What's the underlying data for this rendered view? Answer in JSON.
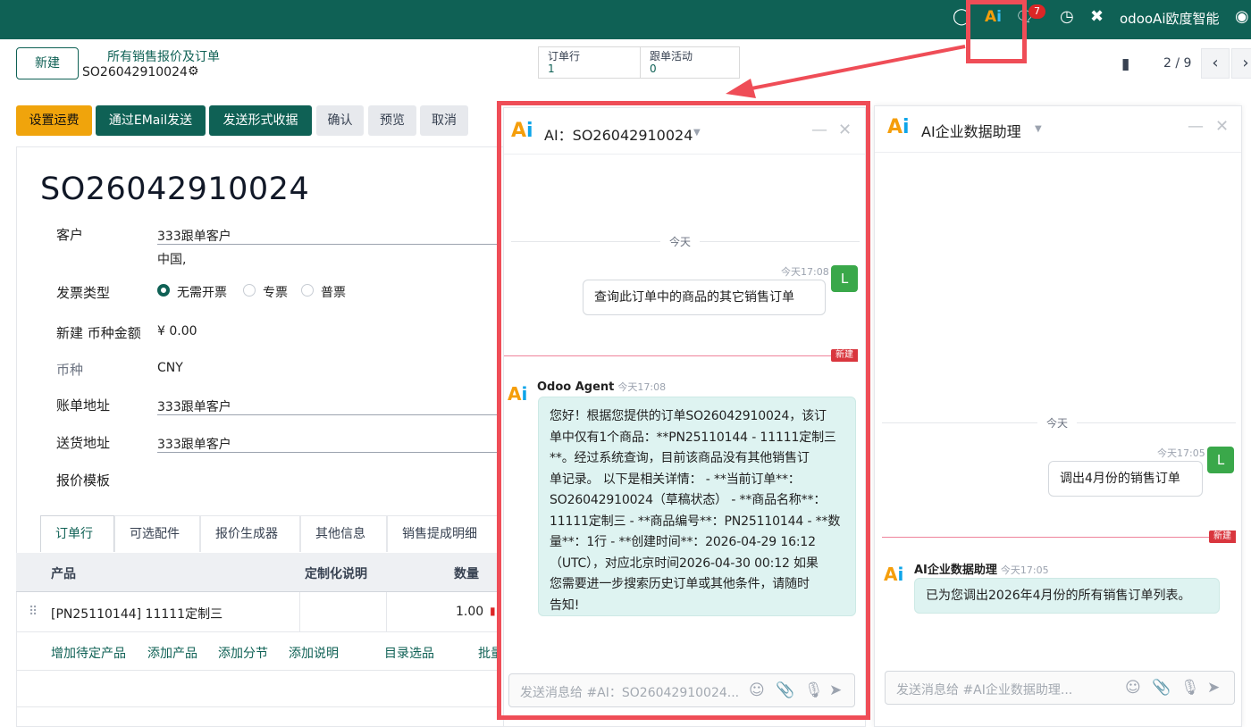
{
  "navbar": {
    "ai_a": "A",
    "ai_i": "i",
    "badge": "7",
    "company": "odooAi欧度智能"
  },
  "control": {
    "new_label": "新建",
    "breadcrumb_parent": "所有销售报价及订单",
    "breadcrumb_current": "SO26042910024",
    "smart_order_lines_label": "订单行",
    "smart_order_lines_value": "1",
    "smart_activities_label": "跟单活动",
    "smart_activities_value": "0",
    "pager": "2 / 9"
  },
  "status_buttons": {
    "shipping": "设置运费",
    "email": "通过EMail发送",
    "proforma": "发送形式收据",
    "confirm": "确认",
    "preview": "预览",
    "cancel": "取消"
  },
  "form": {
    "title": "SO26042910024",
    "customer_label": "客户",
    "customer_value": "333跟单客户",
    "customer_country": "中国,",
    "invoice_type_label": "发票类型",
    "invoice_options": [
      "无需开票",
      "专票",
      "普票"
    ],
    "amount_label": "新建 币种金额",
    "amount_value": "¥ 0.00",
    "currency_label": "币种",
    "currency_value": "CNY",
    "invoice_address_label": "账单地址",
    "invoice_address_value": "333跟单客户",
    "delivery_address_label": "送货地址",
    "delivery_address_value": "333跟单客户",
    "quote_template_label": "报价模板"
  },
  "notebook": {
    "tabs": [
      "订单行",
      "可选配件",
      "报价生成器",
      "其他信息",
      "销售提成明细"
    ],
    "columns": [
      "产品",
      "定制化说明",
      "数量"
    ],
    "row": {
      "product": "[PN25110144] 11111定制三",
      "qty": "1.00"
    },
    "actions": [
      "增加待定产品",
      "添加产品",
      "添加分节",
      "添加说明",
      "目录选品",
      "批量"
    ]
  },
  "chat_order": {
    "title": "AI：SO26042910024",
    "day": "今天",
    "user_ts": "今天17:08",
    "user_avatar": "L",
    "user_msg": "查询此订单中的商品的其它销售订单",
    "new_tag": "新建",
    "agent_name": "Odoo Agent",
    "agent_ts": "今天17:08",
    "agent_lines": [
      "您好！根据您提供的订单SO26042910024，该订",
      "单中仅有1个商品：**PN25110144 - 11111定制三",
      "**。经过系统查询，目前该商品没有其他销售订",
      "单记录。 以下是相关详情： - **当前订单**：",
      "SO26042910024（草稿状态） - **商品名称**：",
      "11111定制三 - **商品编号**：PN25110144 - **数",
      "量**：1行 - **创建时间**：2026-04-29 16:12",
      "（UTC），对应北京时间2026-04-30 00:12 如果",
      "您需要进一步搜索历史订单或其他条件，请随时",
      "告知!"
    ],
    "placeholder": "发送消息给 #AI：SO26042910024..."
  },
  "chat_data": {
    "title": "AI企业数据助理",
    "day": "今天",
    "user_ts": "今天17:05",
    "user_avatar": "L",
    "user_msg": "调出4月份的销售订单",
    "new_tag": "新建",
    "agent_name": "AI企业数据助理",
    "agent_ts": "今天17:05",
    "agent_msg": "已为您调出2026年4月份的所有销售订单列表。",
    "placeholder": "发送消息给 #AI企业数据助理..."
  }
}
